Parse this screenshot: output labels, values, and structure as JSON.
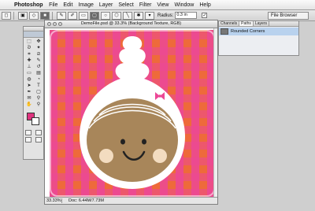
{
  "menubar": {
    "apple": "",
    "app": "Photoshop",
    "items": [
      "File",
      "Edit",
      "Image",
      "Layer",
      "Select",
      "Filter",
      "View",
      "Window",
      "Help"
    ]
  },
  "options": {
    "radius_label": "Radius:",
    "radius_value": "0.3 in",
    "file_browser": "File Browser"
  },
  "document": {
    "title": "DemoFile.psd @ 33.3% (Background Texture, RGB)",
    "zoom": "33.33%",
    "doc_size": "Doc: 6.44M/7.73M"
  },
  "palette": {
    "tabs": [
      "Channels",
      "Paths",
      "Layers"
    ],
    "active_tab": 1,
    "row_label": "Rounded Corners"
  },
  "colors": {
    "foreground": "#e0337f",
    "background": "#ffffff",
    "plaid_orange": "#ee6a3a",
    "plaid_pink": "#ec4896",
    "face_brown": "#a8865a"
  },
  "tool_icons": [
    "marquee-icon",
    "move-icon",
    "lasso-icon",
    "magic-wand-icon",
    "crop-icon",
    "slice-icon",
    "healing-icon",
    "brush-icon",
    "stamp-icon",
    "history-brush-icon",
    "eraser-icon",
    "gradient-icon",
    "blur-icon",
    "dodge-icon",
    "path-select-icon",
    "type-icon",
    "pen-icon",
    "shape-icon",
    "notes-icon",
    "eyedropper-icon",
    "hand-icon",
    "zoom-icon"
  ]
}
